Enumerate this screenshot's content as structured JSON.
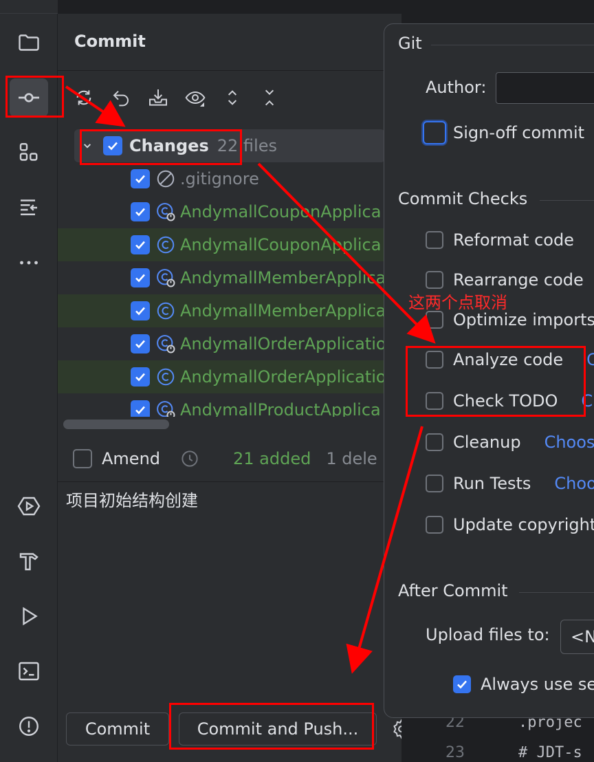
{
  "strip": {
    "icons": [
      "folder-icon",
      "commit-icon",
      "structure-icon",
      "pull-requests-icon",
      "more-icon",
      "services-icon",
      "build-icon",
      "run-icon",
      "terminal-icon",
      "problems-icon"
    ]
  },
  "panel": {
    "title": "Commit",
    "toolbar": [
      "refresh-icon",
      "rollback-icon",
      "shelve-icon",
      "preview-icon",
      "expand-all-icon",
      "collapse-all-icon"
    ],
    "group": {
      "label": "Changes",
      "count": "22 files",
      "checked": true
    },
    "files": [
      {
        "name": ".gitignore",
        "color": "gray",
        "icon": "ignored-icon",
        "highlighted": false
      },
      {
        "name": "AndymallCouponApplica",
        "color": "green",
        "icon": "class-run-icon",
        "highlighted": false
      },
      {
        "name": "AndymallCouponApplica",
        "color": "green",
        "icon": "class-icon",
        "highlighted": true
      },
      {
        "name": "AndymallMemberApplica",
        "color": "green",
        "icon": "class-run-icon",
        "highlighted": false
      },
      {
        "name": "AndymallMemberApplica",
        "color": "green",
        "icon": "class-icon",
        "highlighted": true
      },
      {
        "name": "AndymallOrderApplicatio",
        "color": "green",
        "icon": "class-run-icon",
        "highlighted": false
      },
      {
        "name": "AndymallOrderApplicatio",
        "color": "green",
        "icon": "class-icon",
        "highlighted": true
      },
      {
        "name": "AndymallProductApplica",
        "color": "green",
        "icon": "class-run-icon",
        "highlighted": false
      }
    ],
    "amend_label": "Amend",
    "stats": {
      "added": "21 added",
      "deleted": "1 dele"
    },
    "message": "项目初始结构创建",
    "commit_button": "Commit",
    "commit_push_button": "Commit and Push..."
  },
  "popup": {
    "git_title": "Git",
    "author_label": "Author:",
    "signoff_label": "Sign-off commit",
    "checks_title": "Commit Checks",
    "checks": [
      {
        "label": "Reformat code",
        "link": ""
      },
      {
        "label": "Rearrange code",
        "link": ""
      },
      {
        "label": "Optimize imports",
        "link": ""
      },
      {
        "label": "Analyze code",
        "link": "C"
      },
      {
        "label": "Check TODO",
        "link": "C"
      },
      {
        "label": "Cleanup",
        "link": "Choos"
      },
      {
        "label": "Run Tests",
        "link": "Choo"
      },
      {
        "label": "Update copyright",
        "link": ""
      }
    ],
    "after_title": "After Commit",
    "upload_label": "Upload files to:",
    "upload_value": "<N",
    "always_label": "Always use se"
  },
  "editor": {
    "line1_num": "22",
    "line1_code": ".projec",
    "line2_num": "23",
    "line2_code": "# JDT-s"
  },
  "annotation": {
    "note": "这两个点取消",
    "color": "#ff0000"
  },
  "colors": {
    "accent": "#3574f0",
    "added": "#5fa455",
    "link": "#548af7",
    "background": "#2b2d30"
  }
}
